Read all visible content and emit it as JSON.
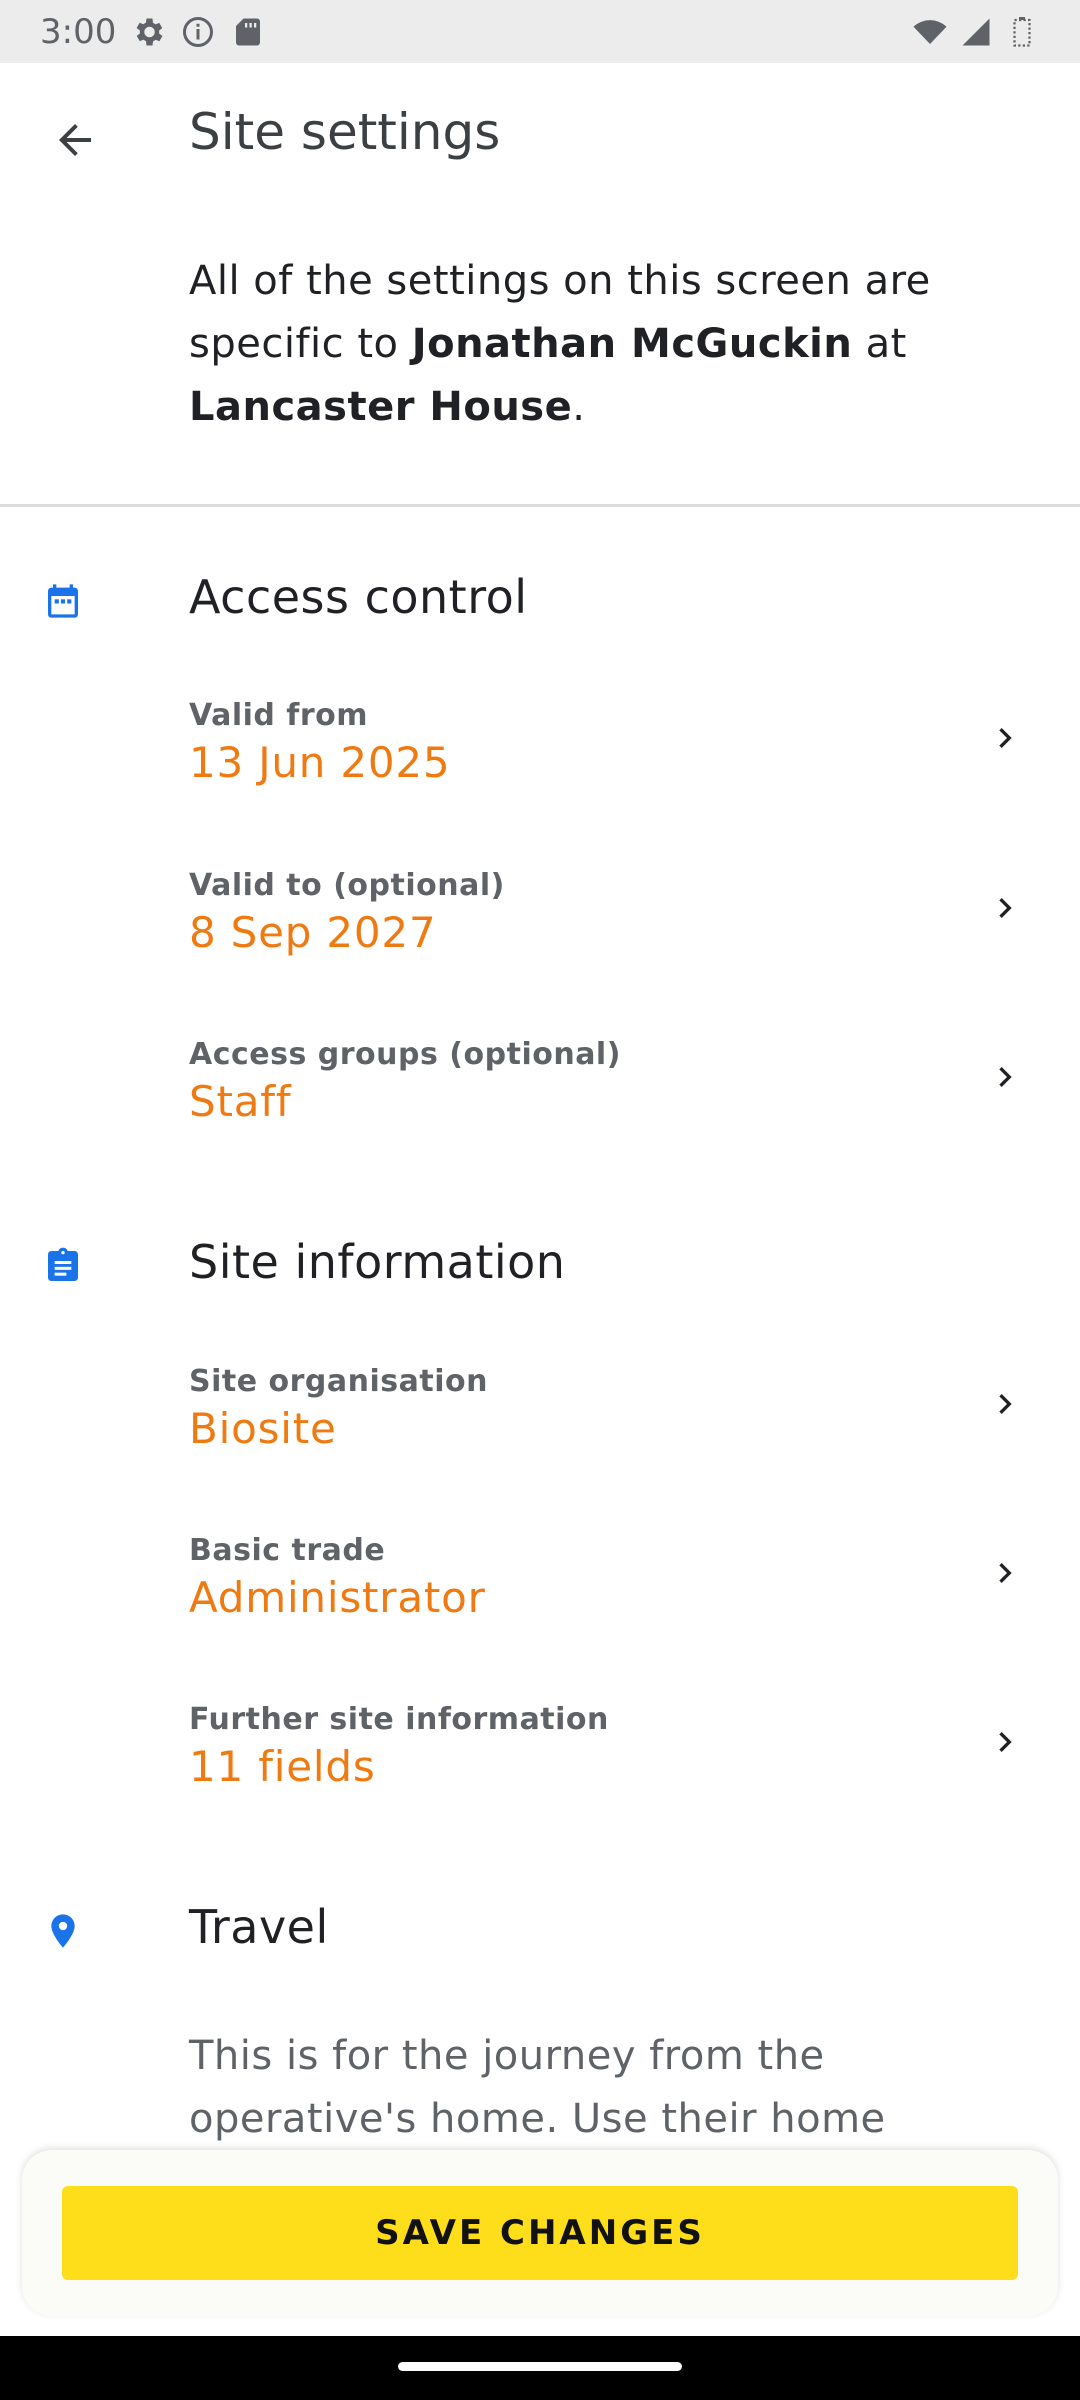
{
  "status_bar": {
    "time": "3:00",
    "icons": [
      "settings-icon",
      "info-icon",
      "sd-card-icon",
      "wifi-icon",
      "signal-icon",
      "battery-icon"
    ]
  },
  "app_bar": {
    "title": "Site settings",
    "back_icon": "arrow-back-icon"
  },
  "intro": {
    "prefix": "All of the settings on this screen are specific to ",
    "person": "Jonathan McGuckin",
    "middle": " at ",
    "site": "Lancaster House",
    "suffix": "."
  },
  "sections": {
    "access_control": {
      "title": "Access control",
      "icon": "calendar-icon",
      "rows": [
        {
          "label": "Valid from",
          "value": "13 Jun 2025"
        },
        {
          "label": "Valid to (optional)",
          "value": "8 Sep 2027"
        },
        {
          "label": "Access groups (optional)",
          "value": "Staff"
        }
      ]
    },
    "site_information": {
      "title": "Site information",
      "icon": "clipboard-icon",
      "rows": [
        {
          "label": "Site organisation",
          "value": "Biosite"
        },
        {
          "label": "Basic trade",
          "value": "Administrator"
        },
        {
          "label": "Further site information",
          "value": "11 fields"
        }
      ]
    },
    "travel": {
      "title": "Travel",
      "icon": "location-pin-icon",
      "text": "This is for the journey from the operative's home. Use their home"
    }
  },
  "save_button": {
    "label": "SAVE CHANGES"
  },
  "colors": {
    "accent_value": "#f07a12",
    "section_icon": "#1a73e8",
    "save_button": "#fedd1b"
  }
}
